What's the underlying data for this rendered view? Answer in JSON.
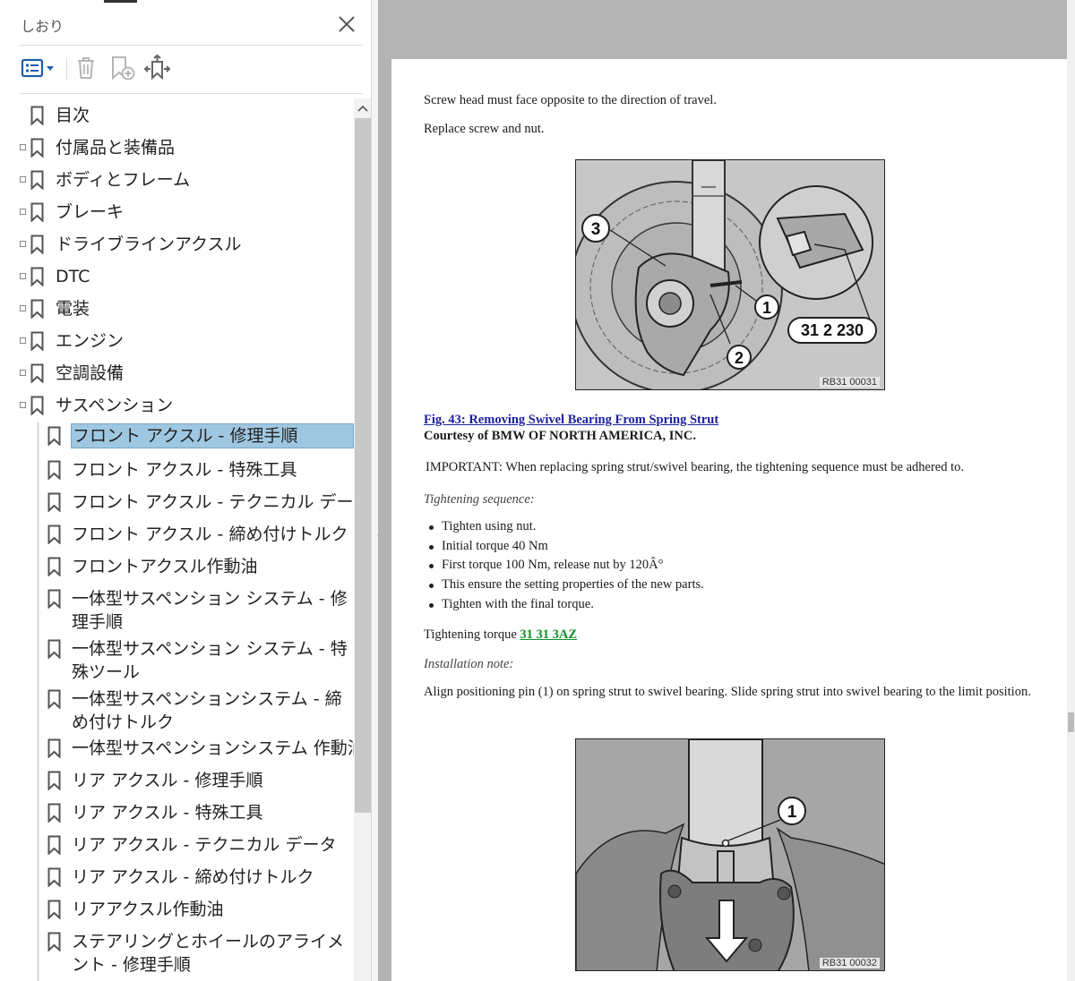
{
  "sidebar": {
    "title": "しおり",
    "toolbar": {
      "options_icon": "options-list-icon",
      "delete_icon": "trash-icon",
      "new_bookmark_icon": "add-bookmark-icon",
      "expand_icon": "expand-bookmark-icon"
    },
    "top_level": [
      {
        "label": "目次",
        "expandable": false
      },
      {
        "label": "付属品と装備品",
        "expandable": true
      },
      {
        "label": "ボディとフレーム",
        "expandable": true
      },
      {
        "label": "ブレーキ",
        "expandable": true
      },
      {
        "label": "ドライブラインアクスル",
        "expandable": true
      },
      {
        "label": "DTC",
        "expandable": true
      },
      {
        "label": "電装",
        "expandable": true
      },
      {
        "label": "エンジン",
        "expandable": true
      },
      {
        "label": "空調設備",
        "expandable": true
      },
      {
        "label": "サスペンション",
        "expandable": true
      }
    ],
    "children": [
      {
        "label": "フロント アクスル - 修理手順",
        "selected": true
      },
      {
        "label": "フロント アクスル - 特殊工具"
      },
      {
        "label": "フロント アクスル - テクニカル データ"
      },
      {
        "label": "フロント アクスル - 締め付けトルク"
      },
      {
        "label": "フロントアクスル作動油"
      },
      {
        "label": "一体型サスペンション システム - 修理手順"
      },
      {
        "label": "一体型サスペンション システム - 特殊ツール"
      },
      {
        "label": "一体型サスペンションシステム - 締め付けトルク"
      },
      {
        "label": "一体型サスペンションシステム 作動油"
      },
      {
        "label": "リア アクスル - 修理手順"
      },
      {
        "label": "リア アクスル - 特殊工具"
      },
      {
        "label": "リア アクスル - テクニカル データ"
      },
      {
        "label": "リア アクスル - 締め付けトルク"
      },
      {
        "label": "リアアクスル作動油"
      },
      {
        "label": "ステアリングとホイールのアライメント - 修理手順"
      }
    ]
  },
  "document": {
    "p1": "Screw head must face opposite to the direction of travel.",
    "p2": "Replace screw and nut.",
    "fig1": {
      "callouts": [
        "3",
        "1",
        "2"
      ],
      "tool_label": "31 2 230",
      "code": "RB31 00031"
    },
    "fig_caption": "Fig. 43: Removing Swivel Bearing From Spring Strut",
    "courtesy": "Courtesy of BMW OF NORTH AMERICA, INC.",
    "important": "IMPORTANT: When replacing spring strut/swivel bearing, the tightening sequence must be adhered to.",
    "seq_heading": "Tightening sequence:",
    "steps": [
      "Tighten using nut.",
      "Initial torque 40 Nm",
      "First torque 100 Nm, release nut by 120Â°",
      "This ensure the setting properties of the new parts.",
      "Tighten with the final torque."
    ],
    "torque_prefix": "Tightening torque ",
    "torque_link": "31 31 3AZ",
    "install_heading": "Installation note:",
    "install_text": "Align positioning pin (1) on spring strut to swivel bearing. Slide spring strut into swivel bearing to the limit position.",
    "fig2": {
      "callouts": [
        "1"
      ],
      "code": "RB31 00032"
    }
  },
  "colors": {
    "selection": "#9fc7e1",
    "doc_background": "#b4b4b4",
    "figure_link": "#1b1fa0",
    "torque_link": "#0e8f2a"
  }
}
